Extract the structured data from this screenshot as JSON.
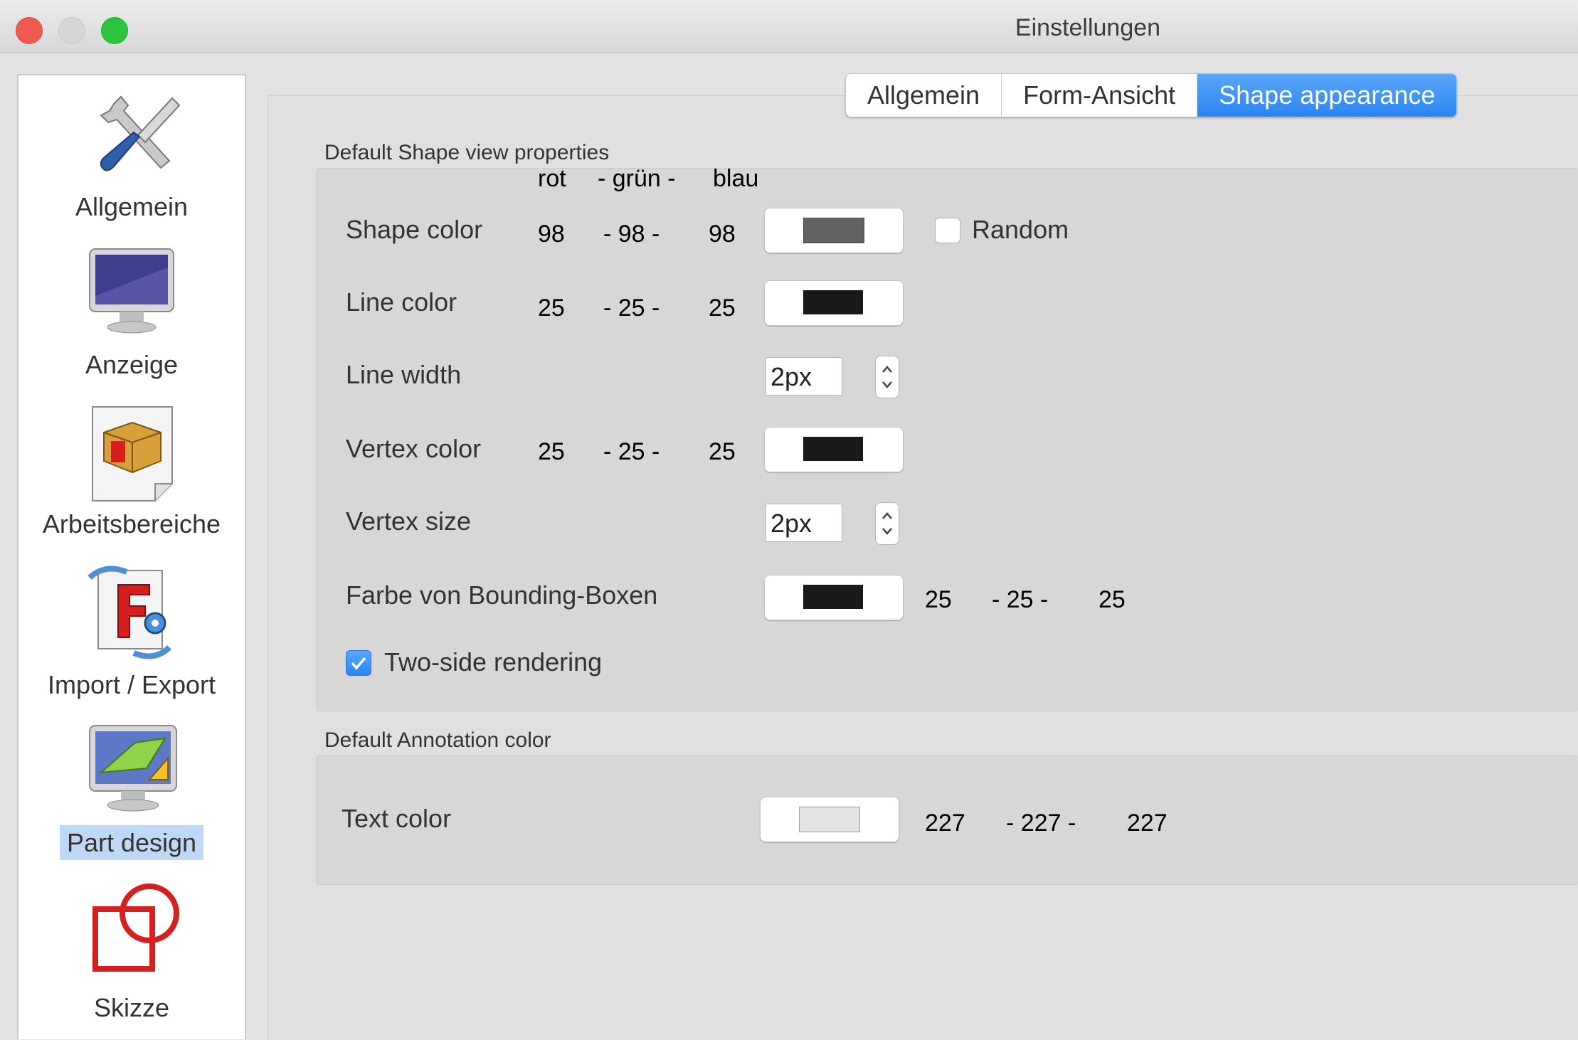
{
  "window": {
    "title": "Einstellungen"
  },
  "sidebar": {
    "items": [
      {
        "label": "Allgemein",
        "icon": "tools-icon",
        "selected": false
      },
      {
        "label": "Anzeige",
        "icon": "monitor-icon",
        "selected": false
      },
      {
        "label": "Arbeitsbereiche",
        "icon": "workbench-box-icon",
        "selected": false
      },
      {
        "label": "Import / Export",
        "icon": "import-export-icon",
        "selected": false
      },
      {
        "label": "Part design",
        "icon": "part-design-icon",
        "selected": true
      },
      {
        "label": "Skizze",
        "icon": "sketch-icon",
        "selected": false
      }
    ]
  },
  "tabs": [
    {
      "label": "Allgemein",
      "active": false
    },
    {
      "label": "Form-Ansicht",
      "active": false
    },
    {
      "label": "Shape appearance",
      "active": true
    }
  ],
  "shape_group": {
    "title": "Default Shape view properties",
    "header": {
      "rot": "rot",
      "gruen": "- grün -",
      "blau": "blau"
    },
    "shape_color": {
      "label": "Shape color",
      "r": "98",
      "g": "- 98 -",
      "b": "98",
      "swatch": "#626262"
    },
    "random": {
      "label": "Random",
      "checked": false
    },
    "line_color": {
      "label": "Line color",
      "r": "25",
      "g": "- 25 -",
      "b": "25",
      "swatch": "#191919"
    },
    "line_width": {
      "label": "Line width",
      "value": "2px"
    },
    "vertex_color": {
      "label": "Vertex color",
      "r": "25",
      "g": "- 25 -",
      "b": "25",
      "swatch": "#191919"
    },
    "vertex_size": {
      "label": "Vertex size",
      "value": "2px"
    },
    "bbox_color": {
      "label": "Farbe von Bounding-Boxen",
      "r": "25",
      "g": "- 25 -",
      "b": "25",
      "swatch": "#191919"
    },
    "two_side": {
      "label": "Two-side rendering",
      "checked": true
    }
  },
  "annotation_group": {
    "title": "Default Annotation color",
    "text_color": {
      "label": "Text color",
      "r": "227",
      "g": "- 227 -",
      "b": "227",
      "swatch": "#e3e3e3"
    }
  },
  "colors": {
    "accent": "#2a85f3",
    "close": "#ee5b52",
    "minimize_disabled": "#d6d6d6",
    "zoom": "#2cc43e"
  }
}
